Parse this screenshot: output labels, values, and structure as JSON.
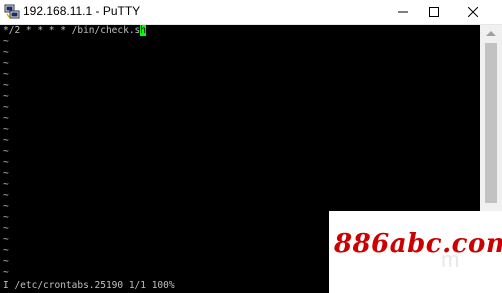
{
  "window": {
    "title": "192.168.11.1 - PuTTY"
  },
  "terminal": {
    "command_line_prefix": "*/2 * * * * /bin/check.s",
    "cursor_char": "h",
    "tilde": "~",
    "status_line": "I /etc/crontabs.25190 1/1 100%"
  },
  "watermark": {
    "text": "886abc.com",
    "ghost_text": "m"
  },
  "colors": {
    "terminal_bg": "#000000",
    "terminal_fg": "#c0c0c0",
    "cursor": "#00ff00",
    "watermark": "#cc0000"
  }
}
